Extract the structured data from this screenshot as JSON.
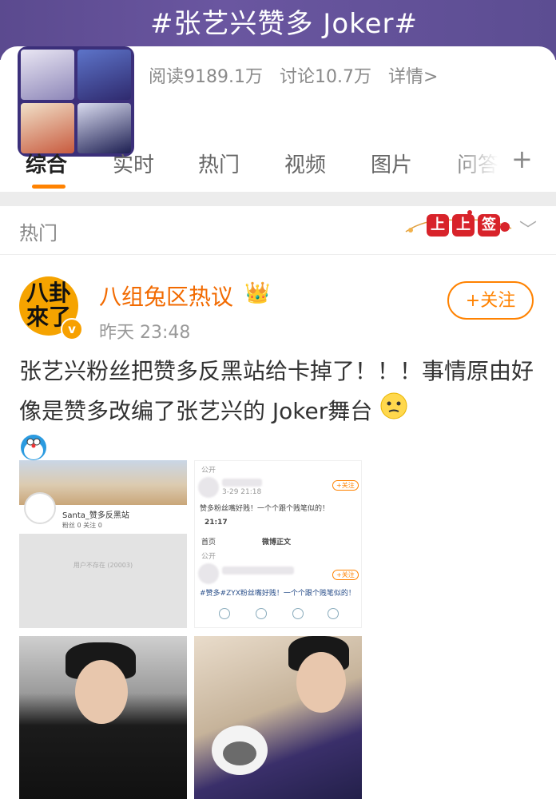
{
  "topic": {
    "title": "#张艺兴赞多 Joker#",
    "reads": "阅读9189.1万",
    "discussions": "讨论10.7万",
    "details": "详情>"
  },
  "tabs": [
    "综合",
    "实时",
    "热门",
    "视频",
    "图片",
    "问答"
  ],
  "tab_plus": "+",
  "sort": {
    "label": "热门"
  },
  "lantern": {
    "chars": [
      "上",
      "上",
      "签"
    ]
  },
  "post": {
    "user": "八组兔区热议",
    "avatar_text": "八卦\n來了",
    "verified": "v",
    "time": "昨天 23:48",
    "follow": "+关注",
    "text": "张艺兴粉丝把赞多反黑站给卡掉了！！！事情原由好像是赞多改编了张艺兴的 Joker舞台",
    "images": {
      "img1": {
        "name": "Santa_赞多反黑站",
        "follow": "粉丝 0  关注 0",
        "notice": "用户不存在 (20003)"
      },
      "img2": {
        "public": "公开",
        "time": "3-29 21:18",
        "text1": "赞多粉丝嘴好贱！一个个跟个贱笔似的！",
        "clock": "21:17",
        "back": "首页",
        "page_title": "微博正文",
        "public2": "公开",
        "text2": "#赞多#ZYX粉丝嘴好贱！一个个跟个贱笔似的！",
        "follow": "+关注"
      }
    }
  }
}
